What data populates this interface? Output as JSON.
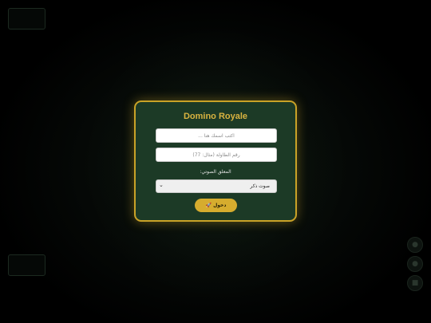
{
  "dialog": {
    "title": "Domino Royale",
    "name_placeholder": "اكتب اسمك هنا ...",
    "room_placeholder": "رقم الطاولة (مثال: 77)",
    "voice_label": "المعلق الصوتي:",
    "voice_selected": "صوت ذكر",
    "enter_label": "دخول 🚀"
  },
  "colors": {
    "panel_bg": "#1c3a26",
    "accent_gold": "#c9a227",
    "background": "#000000"
  },
  "icons": {
    "select_arrow": "chevron-down-icon",
    "side_buttons": [
      "mic-icon",
      "mic-icon",
      "camera-icon"
    ]
  }
}
